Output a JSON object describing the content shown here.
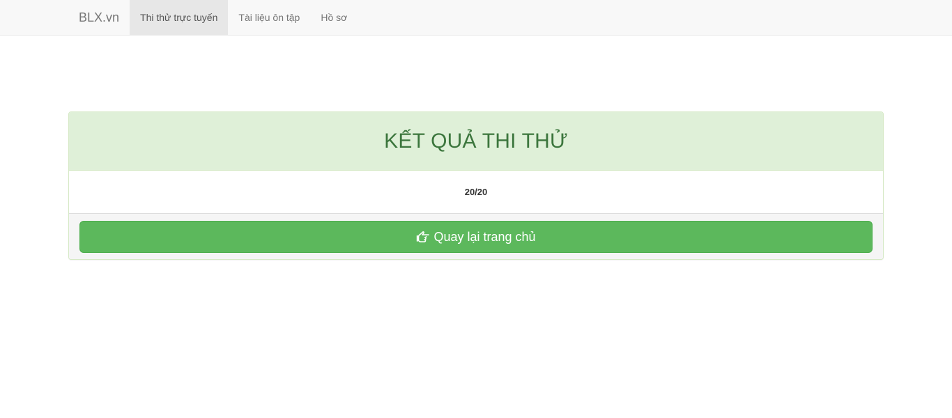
{
  "navbar": {
    "brand": "BLX.vn",
    "items": [
      {
        "label": "Thi thử trực tuyến",
        "active": true
      },
      {
        "label": "Tài liệu ôn tập",
        "active": false
      },
      {
        "label": "Hồ sơ",
        "active": false
      }
    ]
  },
  "result_panel": {
    "title": "KẾT QUẢ THI THỬ",
    "score": "20/20",
    "back_button": {
      "label": "Quay lại trang chủ",
      "icon": "hand-pointing-left-icon"
    }
  },
  "colors": {
    "panel_heading_bg": "#dff0d8",
    "panel_title": "#3c763d",
    "button_bg": "#5cb85c",
    "navbar_bg": "#f8f8f8",
    "nav_active_bg": "#e7e7e7"
  }
}
